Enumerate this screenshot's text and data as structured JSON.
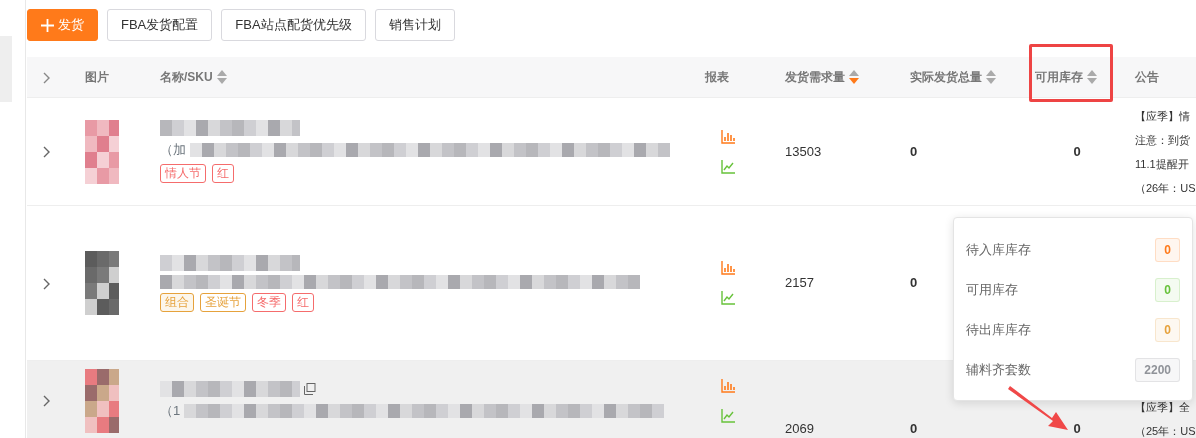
{
  "toolbar": {
    "buttons": [
      {
        "label": "发货",
        "kind": "primary"
      },
      {
        "label": "FBA发货配置",
        "kind": "default"
      },
      {
        "label": "FBA站点配货优先级",
        "kind": "default"
      },
      {
        "label": "销售计划",
        "kind": "default"
      }
    ]
  },
  "table": {
    "columns": [
      {
        "label": "图片",
        "sortable": false,
        "highlighted": false
      },
      {
        "label": "名称/SKU",
        "sortable": true,
        "sorted": false,
        "highlighted": false
      },
      {
        "label": "报表",
        "sortable": false,
        "highlighted": false
      },
      {
        "label": "发货需求量",
        "sortable": true,
        "sorted": true,
        "highlighted": false
      },
      {
        "label": "实际发货总量",
        "sortable": true,
        "sorted": false,
        "highlighted": false
      },
      {
        "label": "可用库存",
        "sortable": true,
        "sorted": false,
        "highlighted": true
      },
      {
        "label": "公告",
        "sortable": false,
        "highlighted": false
      }
    ],
    "rows": [
      {
        "hovered": false,
        "copyable": false,
        "subtitle": "（加",
        "tags": [
          {
            "label": "情人节",
            "kind": "outline",
            "color": "#f56c6c"
          },
          {
            "label": "红",
            "kind": "outline",
            "color": "#f56c6c"
          }
        ],
        "demand": "13503",
        "actual": "0",
        "available": "0",
        "notice": [
          "【应季】情",
          "注意：到货",
          "11.1提醒开",
          "（26年：US"
        ]
      },
      {
        "hovered": false,
        "copyable": false,
        "tags": [
          {
            "label": "组合",
            "kind": "filled",
            "color": "#e6a23c"
          },
          {
            "label": "圣诞节",
            "kind": "outline",
            "color": "#e6a23c"
          },
          {
            "label": "冬季",
            "kind": "outline",
            "color": "#f56c6c"
          },
          {
            "label": "红",
            "kind": "outline",
            "color": "#f56c6c"
          }
        ],
        "demand": "2157",
        "actual": "0",
        "notice": []
      },
      {
        "hovered": true,
        "copyable": true,
        "subtitle": "（1",
        "tags": [],
        "demand": "2069",
        "actual": "0",
        "available": "0",
        "notice": [
          "【应季】全",
          "（25年：US"
        ]
      }
    ]
  },
  "popover": {
    "pointer_arrow": true,
    "items": [
      {
        "label": "待入库库存",
        "value": "0",
        "color": "#ff7a1a"
      },
      {
        "label": "可用库存",
        "value": "0",
        "color": "#67c23a"
      },
      {
        "label": "待出库库存",
        "value": "0",
        "color": "#e6a23c"
      },
      {
        "label": "辅料齐套数",
        "value": "2200",
        "color": "#909399"
      }
    ]
  }
}
